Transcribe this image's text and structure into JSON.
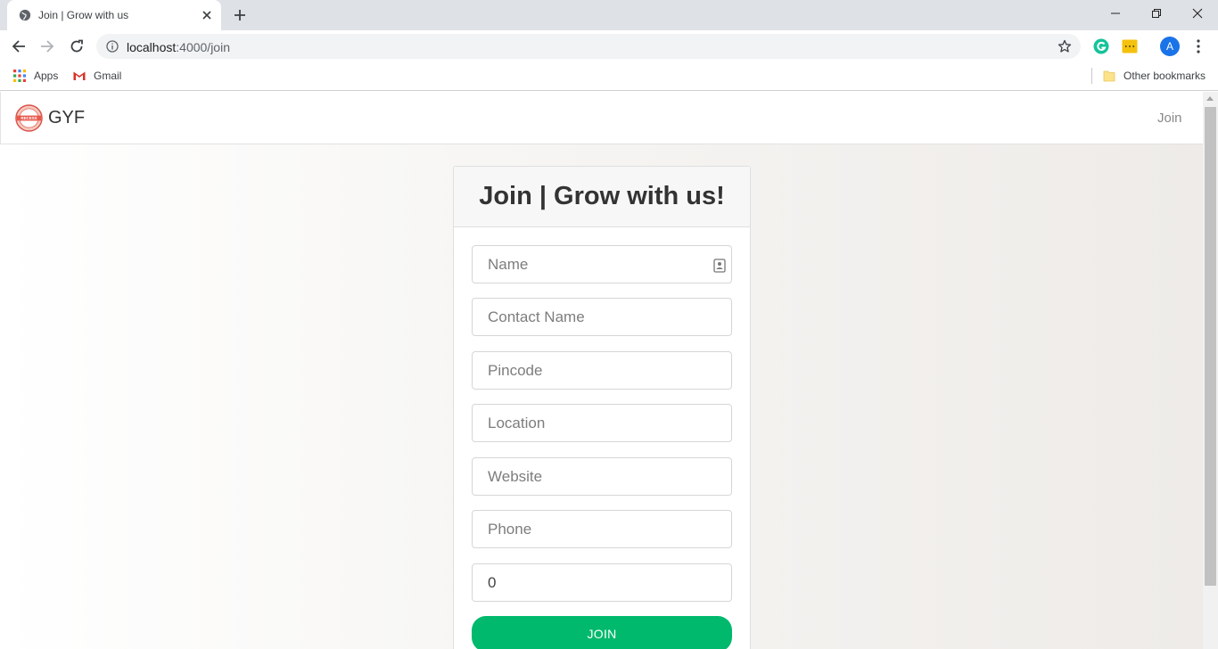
{
  "browser": {
    "tab_title": "Join | Grow with us",
    "url_host": "localhost",
    "url_path": ":4000/join",
    "profile_initial": "A",
    "bookmarks": [
      {
        "label": "Apps",
        "icon": "apps-grid-icon"
      },
      {
        "label": "Gmail",
        "icon": "gmail-icon"
      }
    ],
    "other_bookmarks": "Other bookmarks"
  },
  "navbar": {
    "brand": "GYF",
    "logo_text": "RECESS",
    "join_link": "Join"
  },
  "form": {
    "title": "Join | Grow with us!",
    "fields": [
      {
        "placeholder": "Name",
        "value": ""
      },
      {
        "placeholder": "Contact Name",
        "value": ""
      },
      {
        "placeholder": "Pincode",
        "value": ""
      },
      {
        "placeholder": "Location",
        "value": ""
      },
      {
        "placeholder": "Website",
        "value": ""
      },
      {
        "placeholder": "Phone",
        "value": ""
      },
      {
        "placeholder": "",
        "value": "0"
      }
    ],
    "submit_label": "JOIN"
  },
  "colors": {
    "accent": "#00b96c",
    "profile": "#1a73e8"
  }
}
